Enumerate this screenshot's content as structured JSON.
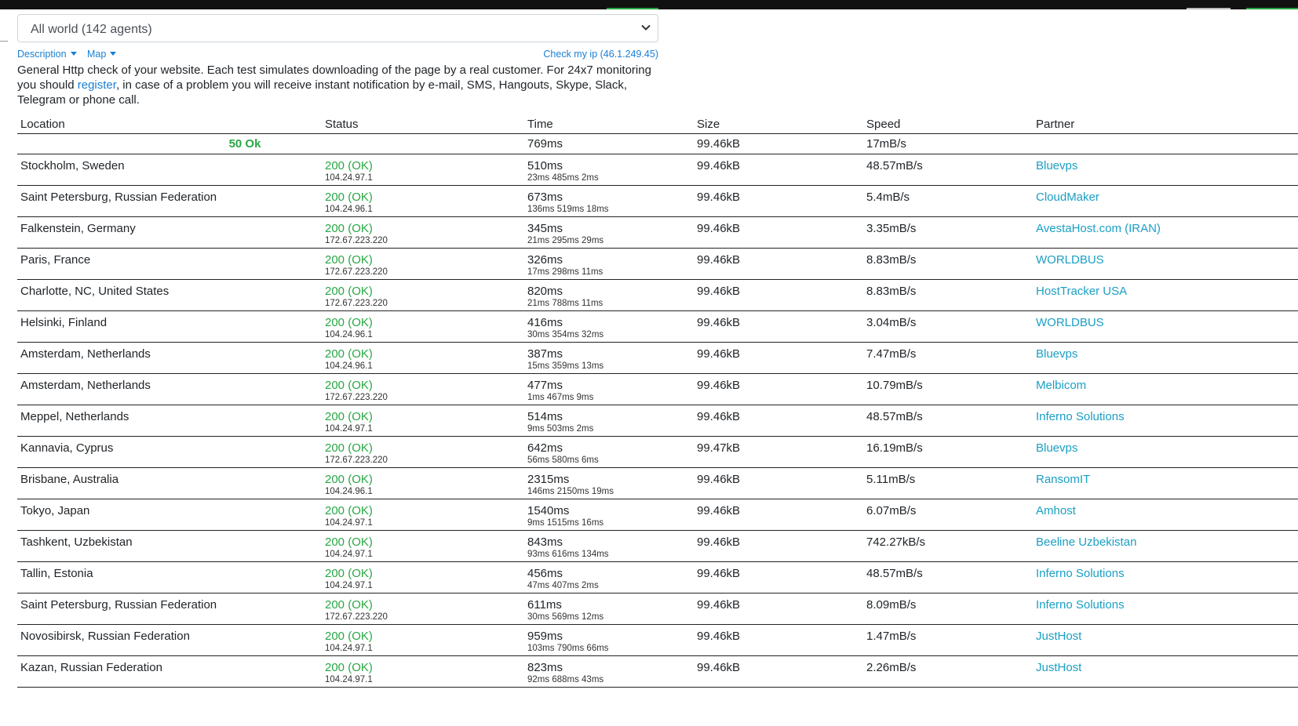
{
  "region_select": {
    "value": "All world (142 agents)"
  },
  "links": {
    "description": "Description",
    "map": "Map",
    "check_ip": "Check my ip (46.1.249.45)"
  },
  "description": {
    "before": "General Http check of your website. Each test simulates downloading of the page by a real customer. For 24x7 monitoring you should ",
    "link": "register",
    "after": ", in case of a problem you will receive instant notification by e-mail, SMS, Hangouts, Skype, Slack, Telegram or phone call."
  },
  "table": {
    "headers": [
      "Location",
      "Status",
      "Time",
      "Size",
      "Speed",
      "Partner"
    ],
    "summary": {
      "status": "50 Ok",
      "time": "769ms",
      "size": "99.46kB",
      "speed": "17mB/s"
    },
    "rows": [
      {
        "location": "Stockholm, Sweden",
        "status": "200 (OK)",
        "ip": "104.24.97.1",
        "time": "510ms",
        "time_detail": "23ms 485ms 2ms",
        "size": "99.46kB",
        "speed": "48.57mB/s",
        "partner": "Bluevps"
      },
      {
        "location": "Saint Petersburg, Russian Federation",
        "status": "200 (OK)",
        "ip": "104.24.96.1",
        "time": "673ms",
        "time_detail": "136ms 519ms 18ms",
        "size": "99.46kB",
        "speed": "5.4mB/s",
        "partner": "CloudMaker"
      },
      {
        "location": "Falkenstein, Germany",
        "status": "200 (OK)",
        "ip": "172.67.223.220",
        "time": "345ms",
        "time_detail": "21ms 295ms 29ms",
        "size": "99.46kB",
        "speed": "3.35mB/s",
        "partner": "AvestaHost.com (IRAN)"
      },
      {
        "location": "Paris, France",
        "status": "200 (OK)",
        "ip": "172.67.223.220",
        "time": "326ms",
        "time_detail": "17ms 298ms 11ms",
        "size": "99.46kB",
        "speed": "8.83mB/s",
        "partner": "WORLDBUS"
      },
      {
        "location": "Charlotte, NC, United States",
        "status": "200 (OK)",
        "ip": "172.67.223.220",
        "time": "820ms",
        "time_detail": "21ms 788ms 11ms",
        "size": "99.46kB",
        "speed": "8.83mB/s",
        "partner": "HostTracker USA"
      },
      {
        "location": "Helsinki, Finland",
        "status": "200 (OK)",
        "ip": "104.24.96.1",
        "time": "416ms",
        "time_detail": "30ms 354ms 32ms",
        "size": "99.46kB",
        "speed": "3.04mB/s",
        "partner": "WORLDBUS"
      },
      {
        "location": "Amsterdam, Netherlands",
        "status": "200 (OK)",
        "ip": "104.24.96.1",
        "time": "387ms",
        "time_detail": "15ms 359ms 13ms",
        "size": "99.46kB",
        "speed": "7.47mB/s",
        "partner": "Bluevps"
      },
      {
        "location": "Amsterdam, Netherlands",
        "status": "200 (OK)",
        "ip": "172.67.223.220",
        "time": "477ms",
        "time_detail": "1ms 467ms 9ms",
        "size": "99.46kB",
        "speed": "10.79mB/s",
        "partner": "Melbicom"
      },
      {
        "location": "Meppel, Netherlands",
        "status": "200 (OK)",
        "ip": "104.24.97.1",
        "time": "514ms",
        "time_detail": "9ms 503ms 2ms",
        "size": "99.46kB",
        "speed": "48.57mB/s",
        "partner": "Inferno Solutions"
      },
      {
        "location": "Kannavia, Cyprus",
        "status": "200 (OK)",
        "ip": "172.67.223.220",
        "time": "642ms",
        "time_detail": "56ms 580ms 6ms",
        "size": "99.47kB",
        "speed": "16.19mB/s",
        "partner": "Bluevps"
      },
      {
        "location": "Brisbane, Australia",
        "status": "200 (OK)",
        "ip": "104.24.96.1",
        "time": "2315ms",
        "time_detail": "146ms 2150ms 19ms",
        "size": "99.46kB",
        "speed": "5.11mB/s",
        "partner": "RansomIT"
      },
      {
        "location": "Tokyo, Japan",
        "status": "200 (OK)",
        "ip": "104.24.97.1",
        "time": "1540ms",
        "time_detail": "9ms 1515ms 16ms",
        "size": "99.46kB",
        "speed": "6.07mB/s",
        "partner": "Amhost"
      },
      {
        "location": "Tashkent, Uzbekistan",
        "status": "200 (OK)",
        "ip": "104.24.97.1",
        "time": "843ms",
        "time_detail": "93ms 616ms 134ms",
        "size": "99.46kB",
        "speed": "742.27kB/s",
        "partner": "Beeline Uzbekistan"
      },
      {
        "location": "Tallin, Estonia",
        "status": "200 (OK)",
        "ip": "104.24.97.1",
        "time": "456ms",
        "time_detail": "47ms 407ms 2ms",
        "size": "99.46kB",
        "speed": "48.57mB/s",
        "partner": "Inferno Solutions"
      },
      {
        "location": "Saint Petersburg, Russian Federation",
        "status": "200 (OK)",
        "ip": "172.67.223.220",
        "time": "611ms",
        "time_detail": "30ms 569ms 12ms",
        "size": "99.46kB",
        "speed": "8.09mB/s",
        "partner": "Inferno Solutions"
      },
      {
        "location": "Novosibirsk, Russian Federation",
        "status": "200 (OK)",
        "ip": "104.24.97.1",
        "time": "959ms",
        "time_detail": "103ms 790ms 66ms",
        "size": "99.46kB",
        "speed": "1.47mB/s",
        "partner": "JustHost"
      },
      {
        "location": "Kazan, Russian Federation",
        "status": "200 (OK)",
        "ip": "104.24.97.1",
        "time": "823ms",
        "time_detail": "92ms 688ms 43ms",
        "size": "99.46kB",
        "speed": "2.26mB/s",
        "partner": "JustHost"
      }
    ]
  }
}
